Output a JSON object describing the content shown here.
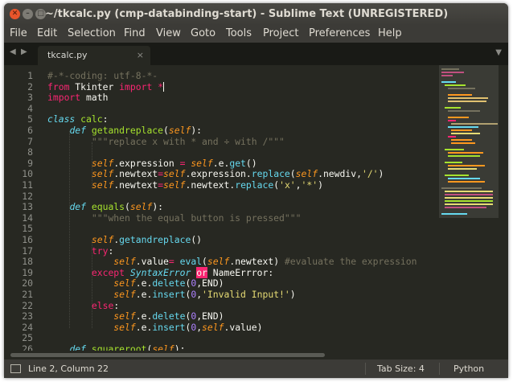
{
  "window": {
    "title": "~/tkcalc.py (cmp-databinding-start) - Sublime Text (UNREGISTERED)",
    "controls": [
      "close",
      "minimize",
      "maximize"
    ]
  },
  "menu": [
    "File",
    "Edit",
    "Selection",
    "Find",
    "View",
    "Goto",
    "Tools",
    "Project",
    "Preferences",
    "Help"
  ],
  "tabs": {
    "nav_left": "◀",
    "nav_right": "▶",
    "active": {
      "name": "tkcalc.py",
      "close": "×"
    },
    "dropdown": "▼"
  },
  "editor": {
    "line_numbers": [
      "1",
      "2",
      "3",
      "4",
      "5",
      "6",
      "7",
      "8",
      "9",
      "10",
      "11",
      "12",
      "13",
      "14",
      "15",
      "16",
      "17",
      "18",
      "19",
      "20",
      "21",
      "22",
      "23",
      "24",
      "25",
      "26"
    ],
    "lines": [
      [
        {
          "t": "#-*-coding: utf-8-*-",
          "c": "cm"
        }
      ],
      [
        {
          "t": "from",
          "c": "kw"
        },
        {
          "t": " Tkinter ",
          "c": ""
        },
        {
          "t": "import",
          "c": "kw"
        },
        {
          "t": " ",
          "c": ""
        },
        {
          "t": "*",
          "c": "kw"
        },
        {
          "t": "",
          "c": "cursor"
        }
      ],
      [
        {
          "t": "import",
          "c": "kw"
        },
        {
          "t": " math",
          "c": ""
        }
      ],
      [],
      [
        {
          "t": "class",
          "c": "ty"
        },
        {
          "t": " ",
          "c": ""
        },
        {
          "t": "calc",
          "c": "fn"
        },
        {
          "t": ":",
          "c": ""
        }
      ],
      [
        {
          "t": "    ",
          "c": ""
        },
        {
          "t": "def",
          "c": "ty"
        },
        {
          "t": " ",
          "c": ""
        },
        {
          "t": "getandreplace",
          "c": "fn"
        },
        {
          "t": "(",
          "c": ""
        },
        {
          "t": "self",
          "c": "sf"
        },
        {
          "t": "):",
          "c": ""
        }
      ],
      [
        {
          "t": "        ",
          "c": ""
        },
        {
          "t": "\"\"\"replace x with * and ÷ with /\"\"\"",
          "c": "cm"
        }
      ],
      [],
      [
        {
          "t": "        ",
          "c": ""
        },
        {
          "t": "self",
          "c": "sf"
        },
        {
          "t": ".expression ",
          "c": ""
        },
        {
          "t": "=",
          "c": "kw"
        },
        {
          "t": " ",
          "c": ""
        },
        {
          "t": "self",
          "c": "sf"
        },
        {
          "t": ".e.",
          "c": ""
        },
        {
          "t": "get",
          "c": "bi"
        },
        {
          "t": "()",
          "c": ""
        }
      ],
      [
        {
          "t": "        ",
          "c": ""
        },
        {
          "t": "self",
          "c": "sf"
        },
        {
          "t": ".newtext",
          "c": ""
        },
        {
          "t": "=",
          "c": "kw"
        },
        {
          "t": "self",
          "c": "sf"
        },
        {
          "t": ".expression.",
          "c": ""
        },
        {
          "t": "replace",
          "c": "bi"
        },
        {
          "t": "(",
          "c": ""
        },
        {
          "t": "self",
          "c": "sf"
        },
        {
          "t": ".newdiv,",
          "c": ""
        },
        {
          "t": "'/'",
          "c": "st"
        },
        {
          "t": ")",
          "c": ""
        }
      ],
      [
        {
          "t": "        ",
          "c": ""
        },
        {
          "t": "self",
          "c": "sf"
        },
        {
          "t": ".newtext",
          "c": ""
        },
        {
          "t": "=",
          "c": "kw"
        },
        {
          "t": "self",
          "c": "sf"
        },
        {
          "t": ".newtext.",
          "c": ""
        },
        {
          "t": "replace",
          "c": "bi"
        },
        {
          "t": "(",
          "c": ""
        },
        {
          "t": "'x'",
          "c": "st"
        },
        {
          "t": ",",
          "c": ""
        },
        {
          "t": "'*'",
          "c": "st"
        },
        {
          "t": ")",
          "c": ""
        }
      ],
      [],
      [
        {
          "t": "    ",
          "c": ""
        },
        {
          "t": "def",
          "c": "ty"
        },
        {
          "t": " ",
          "c": ""
        },
        {
          "t": "equals",
          "c": "fn"
        },
        {
          "t": "(",
          "c": ""
        },
        {
          "t": "self",
          "c": "sf"
        },
        {
          "t": "):",
          "c": ""
        }
      ],
      [
        {
          "t": "        ",
          "c": ""
        },
        {
          "t": "\"\"\"when the equal button is pressed\"\"\"",
          "c": "cm"
        }
      ],
      [],
      [
        {
          "t": "        ",
          "c": ""
        },
        {
          "t": "self",
          "c": "sf"
        },
        {
          "t": ".",
          "c": ""
        },
        {
          "t": "getandreplace",
          "c": "bi"
        },
        {
          "t": "()",
          "c": ""
        }
      ],
      [
        {
          "t": "        ",
          "c": ""
        },
        {
          "t": "try",
          "c": "kw"
        },
        {
          "t": ":",
          "c": ""
        }
      ],
      [
        {
          "t": "            ",
          "c": ""
        },
        {
          "t": "self",
          "c": "sf"
        },
        {
          "t": ".value",
          "c": ""
        },
        {
          "t": "=",
          "c": "kw"
        },
        {
          "t": " ",
          "c": ""
        },
        {
          "t": "eval",
          "c": "bi"
        },
        {
          "t": "(",
          "c": ""
        },
        {
          "t": "self",
          "c": "sf"
        },
        {
          "t": ".newtext) ",
          "c": ""
        },
        {
          "t": "#evaluate the expression",
          "c": "cm"
        }
      ],
      [
        {
          "t": "        ",
          "c": ""
        },
        {
          "t": "except",
          "c": "kw"
        },
        {
          "t": " ",
          "c": ""
        },
        {
          "t": "SyntaxError",
          "c": "ty"
        },
        {
          "t": " ",
          "c": ""
        },
        {
          "t": "or",
          "c": "hl"
        },
        {
          "t": " NameErrror:",
          "c": ""
        }
      ],
      [
        {
          "t": "            ",
          "c": ""
        },
        {
          "t": "self",
          "c": "sf"
        },
        {
          "t": ".e.",
          "c": ""
        },
        {
          "t": "delete",
          "c": "bi"
        },
        {
          "t": "(",
          "c": ""
        },
        {
          "t": "0",
          "c": "nu"
        },
        {
          "t": ",END)",
          "c": ""
        }
      ],
      [
        {
          "t": "            ",
          "c": ""
        },
        {
          "t": "self",
          "c": "sf"
        },
        {
          "t": ".e.",
          "c": ""
        },
        {
          "t": "insert",
          "c": "bi"
        },
        {
          "t": "(",
          "c": ""
        },
        {
          "t": "0",
          "c": "nu"
        },
        {
          "t": ",",
          "c": ""
        },
        {
          "t": "'Invalid Input!'",
          "c": "st"
        },
        {
          "t": ")",
          "c": ""
        }
      ],
      [
        {
          "t": "        ",
          "c": ""
        },
        {
          "t": "else",
          "c": "kw"
        },
        {
          "t": ":",
          "c": ""
        }
      ],
      [
        {
          "t": "            ",
          "c": ""
        },
        {
          "t": "self",
          "c": "sf"
        },
        {
          "t": ".e.",
          "c": ""
        },
        {
          "t": "delete",
          "c": "bi"
        },
        {
          "t": "(",
          "c": ""
        },
        {
          "t": "0",
          "c": "nu"
        },
        {
          "t": ",END)",
          "c": ""
        }
      ],
      [
        {
          "t": "            ",
          "c": ""
        },
        {
          "t": "self",
          "c": "sf"
        },
        {
          "t": ".e.",
          "c": ""
        },
        {
          "t": "insert",
          "c": "bi"
        },
        {
          "t": "(",
          "c": ""
        },
        {
          "t": "0",
          "c": "nu"
        },
        {
          "t": ",",
          "c": ""
        },
        {
          "t": "self",
          "c": "sf"
        },
        {
          "t": ".value)",
          "c": ""
        }
      ],
      [],
      [
        {
          "t": "    ",
          "c": ""
        },
        {
          "t": "def",
          "c": "ty"
        },
        {
          "t": " ",
          "c": ""
        },
        {
          "t": "squareroot",
          "c": "fn"
        },
        {
          "t": "(",
          "c": ""
        },
        {
          "t": "self",
          "c": "sf"
        },
        {
          "t": "):",
          "c": ""
        }
      ]
    ]
  },
  "statusbar": {
    "position": "Line 2, Column 22",
    "tab_size": "Tab Size: 4",
    "syntax": "Python"
  },
  "colors": {
    "background": "#272822",
    "keyword": "#f92672",
    "string": "#e6db74",
    "comment": "#75715e",
    "function": "#a6e22e",
    "self": "#fd971f",
    "number": "#ae81ff",
    "type": "#66d9ef"
  }
}
